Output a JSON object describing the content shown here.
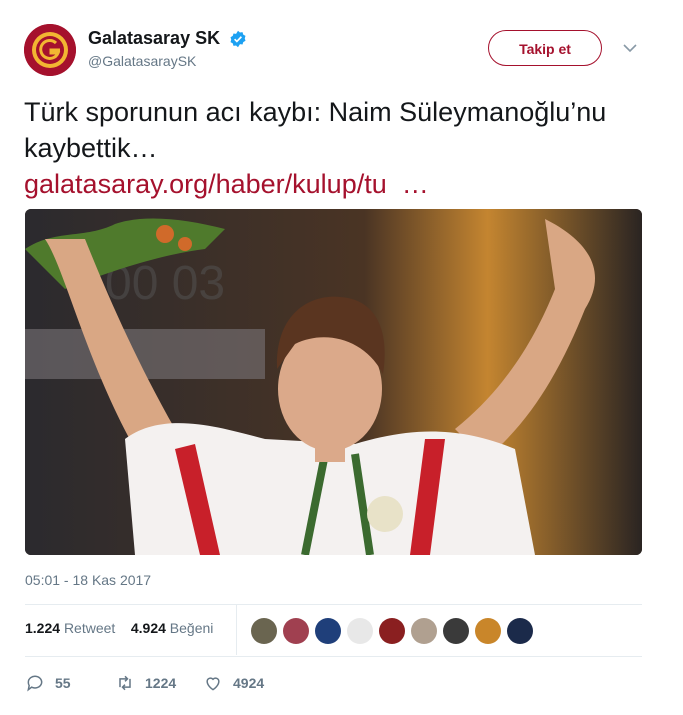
{
  "account": {
    "display_name": "Galatasaray SK",
    "handle": "@GalatasaraySK",
    "verified_icon": "verified-badge-icon",
    "brand_color": "#a5112d"
  },
  "follow_button": {
    "label": "Takip et"
  },
  "menu_icon": "chevron-down-icon",
  "tweet": {
    "text": "Türk sporunun acı kaybı: Naim Süleymanoğlu’nu kaybettik…",
    "link": "galatasaray.org/haber/kulup/tu",
    "link_ellipsis": "…",
    "media_alt": "photo"
  },
  "timestamp": "05:01 - 18 Kas 2017",
  "stats": {
    "retweets_value": "1.224",
    "retweets_label": "Retweet",
    "likes_value": "4.924",
    "likes_label": "Beğeni"
  },
  "liker_avatars": [
    "avatar-1",
    "avatar-2",
    "avatar-3",
    "avatar-4",
    "avatar-5",
    "avatar-6",
    "avatar-7",
    "avatar-8",
    "avatar-9"
  ],
  "actions": {
    "reply_count": "55",
    "retweet_count": "1224",
    "like_count": "4924"
  }
}
